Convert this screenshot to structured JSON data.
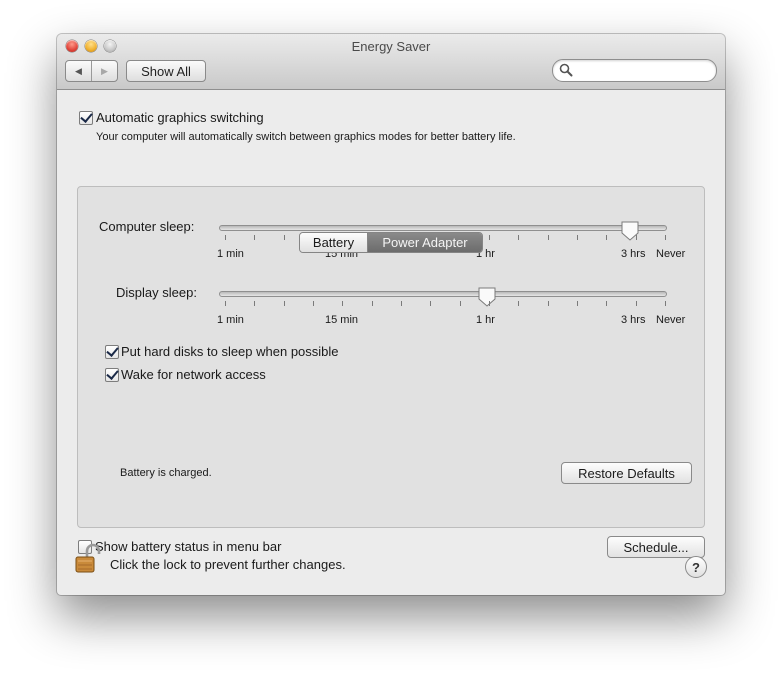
{
  "window": {
    "title": "Energy Saver"
  },
  "toolbar": {
    "back_icon": "◀",
    "forward_icon": "▶",
    "show_all_label": "Show All",
    "search_placeholder": "",
    "search_value": ""
  },
  "graphics": {
    "label": "Automatic graphics switching",
    "checked": true,
    "description": "Your computer will automatically switch between graphics modes for better battery life."
  },
  "tabs": [
    {
      "label": "Battery",
      "selected": false
    },
    {
      "label": "Power Adapter",
      "selected": true
    }
  ],
  "sliders": [
    {
      "label": "Computer sleep:",
      "tick_labels": [
        "1 min",
        "15 min",
        "1 hr",
        "3 hrs",
        "Never"
      ],
      "value": "3 hrs",
      "position_fraction": 0.92
    },
    {
      "label": "Display sleep:",
      "tick_labels": [
        "1 min",
        "15 min",
        "1 hr",
        "3 hrs",
        "Never"
      ],
      "value": "1 hr",
      "position_fraction": 0.595
    }
  ],
  "options": [
    {
      "label": "Put hard disks to sleep when possible",
      "checked": true
    },
    {
      "label": "Wake for network access",
      "checked": true
    }
  ],
  "status": {
    "battery_text": "Battery is charged.",
    "restore_label": "Restore Defaults"
  },
  "menu_bar_option": {
    "label": "Show battery status in menu bar",
    "checked": false
  },
  "schedule_label": "Schedule...",
  "lock": {
    "text": "Click the lock to prevent further changes.",
    "icon": "lock-open-icon"
  },
  "help_label": "?",
  "colors": {
    "selected_tab": "#737373",
    "window_bg": "#ececec",
    "panel_bg": "#e1e1e1"
  }
}
